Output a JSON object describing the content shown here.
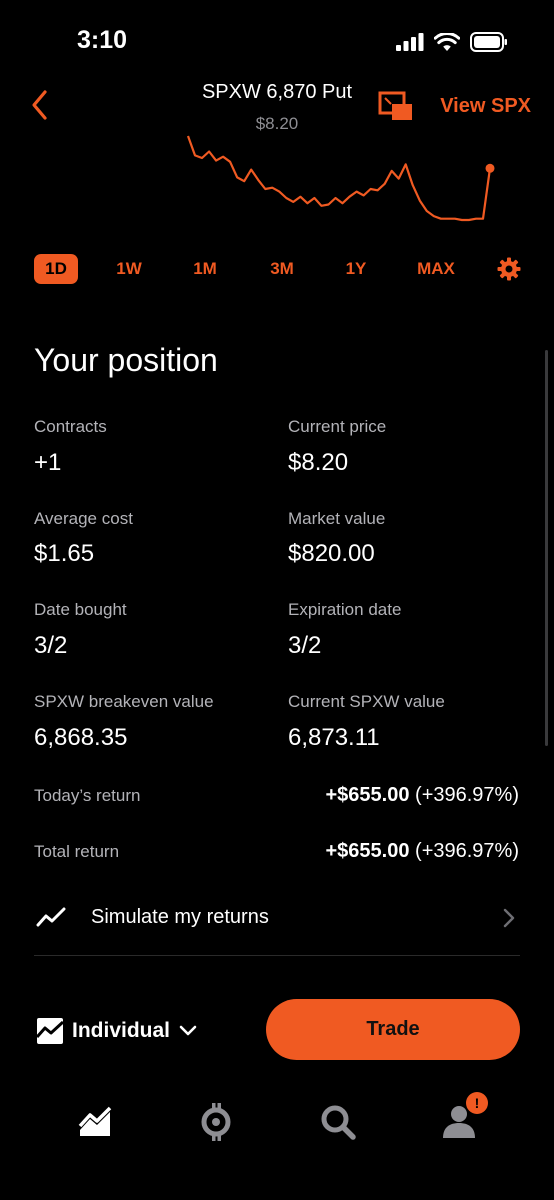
{
  "status_bar": {
    "time": "3:10"
  },
  "header": {
    "title": "SPXW 6,870 Put",
    "subtitle": "$8.20",
    "view_link": "View SPX"
  },
  "chart": {
    "color": "#f05a22",
    "values": [
      9.0,
      7.5,
      7.3,
      7.8,
      7.1,
      7.4,
      7.0,
      5.8,
      5.5,
      6.4,
      5.6,
      4.9,
      5.0,
      4.7,
      4.2,
      3.9,
      4.3,
      3.8,
      4.2,
      3.6,
      3.7,
      4.2,
      3.8,
      4.3,
      4.7,
      4.4,
      4.9,
      4.8,
      5.3,
      6.3,
      5.7,
      6.8,
      5.2,
      4.0,
      3.2,
      2.8,
      2.6,
      2.6,
      2.6,
      2.5,
      2.5,
      2.6,
      2.6,
      6.5
    ]
  },
  "ranges": [
    "1D",
    "1W",
    "1M",
    "3M",
    "1Y",
    "MAX"
  ],
  "active_range": "1D",
  "position": {
    "title": "Your position",
    "contracts_label": "Contracts",
    "contracts_value": "+1",
    "current_price_label": "Current price",
    "current_price_value": "$8.20",
    "avg_cost_label": "Average cost",
    "avg_cost_value": "$1.65",
    "market_value_label": "Market value",
    "market_value_value": "$820.00",
    "date_bought_label": "Date bought",
    "date_bought_value": "3/2",
    "expiration_label": "Expiration date",
    "expiration_value": "3/2",
    "breakeven_label": "SPXW breakeven value",
    "breakeven_value": "6,868.35",
    "current_spxw_label": "Current SPXW value",
    "current_spxw_value": "6,873.11",
    "todays_return_label": "Today’s return",
    "todays_return_amount": "+$655.00",
    "todays_return_pct": "(+396.97%)",
    "total_return_label": "Total return",
    "total_return_amount": "+$655.00",
    "total_return_pct": "(+396.97%)"
  },
  "simulate": {
    "label": "Simulate my returns"
  },
  "bottom": {
    "account_label": "Individual",
    "trade_label": "Trade"
  },
  "nav": {
    "badge": "!"
  },
  "colors": {
    "accent": "#f05a22",
    "background": "#000000",
    "muted": "#b3b3b8"
  }
}
